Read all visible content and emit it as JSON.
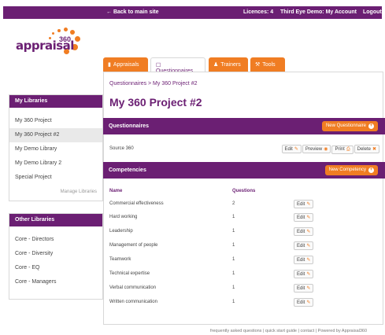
{
  "topbar": {
    "back": "← Back to main site",
    "licences": "Licences: 4",
    "account": "Third Eye Demo: My Account",
    "logout": "Logout"
  },
  "logo": {
    "text": "appraisal",
    "sup": "360"
  },
  "my_libraries": {
    "title": "My Libraries",
    "items": [
      "My 360 Project",
      "My 360 Project #2",
      "My Demo Library",
      "My Demo Library 2",
      "Special Project"
    ],
    "selected_index": 1,
    "manage": "Manage Libraries"
  },
  "other_libraries": {
    "title": "Other Libraries",
    "items": [
      "Core - Directors",
      "Core - Diversity",
      "Core - EQ",
      "Core - Managers"
    ]
  },
  "tabs": [
    {
      "label": "Appraisals",
      "icon": "clipboard-icon"
    },
    {
      "label": "Questionnaires",
      "icon": "questionnaire-icon"
    },
    {
      "label": "Trainers",
      "icon": "people-icon"
    },
    {
      "label": "Tools",
      "icon": "tools-icon"
    }
  ],
  "main": {
    "breadcrumb": "Questionnaires  >  My 360 Project #2",
    "title": "My 360 Project #2",
    "questionnaires_header": "Questionnaires",
    "new_questionnaire": "New Questionnaire",
    "source_label": "Source 360",
    "buttons": {
      "edit": "Edit",
      "preview": "Preview",
      "print": "Print",
      "delete": "Delete"
    },
    "competencies_header": "Competencies",
    "new_competency": "New Competency",
    "col_name": "Name",
    "col_questions": "Questions",
    "competencies": [
      {
        "name": "Commercial effectiveness",
        "questions": "2"
      },
      {
        "name": "Hard working",
        "questions": "1"
      },
      {
        "name": "Leadership",
        "questions": "1"
      },
      {
        "name": "Management of people",
        "questions": "1"
      },
      {
        "name": "Teamwork",
        "questions": "1"
      },
      {
        "name": "Technical expertise",
        "questions": "1"
      },
      {
        "name": "Verbal communication",
        "questions": "1"
      },
      {
        "name": "Written communication",
        "questions": "1"
      }
    ]
  },
  "footer": "frequently asked questions | quick start guide | contact | Powered by Appraisal360",
  "colors": {
    "brand_purple": "#6b1f73",
    "accent_orange": "#f07d23"
  }
}
